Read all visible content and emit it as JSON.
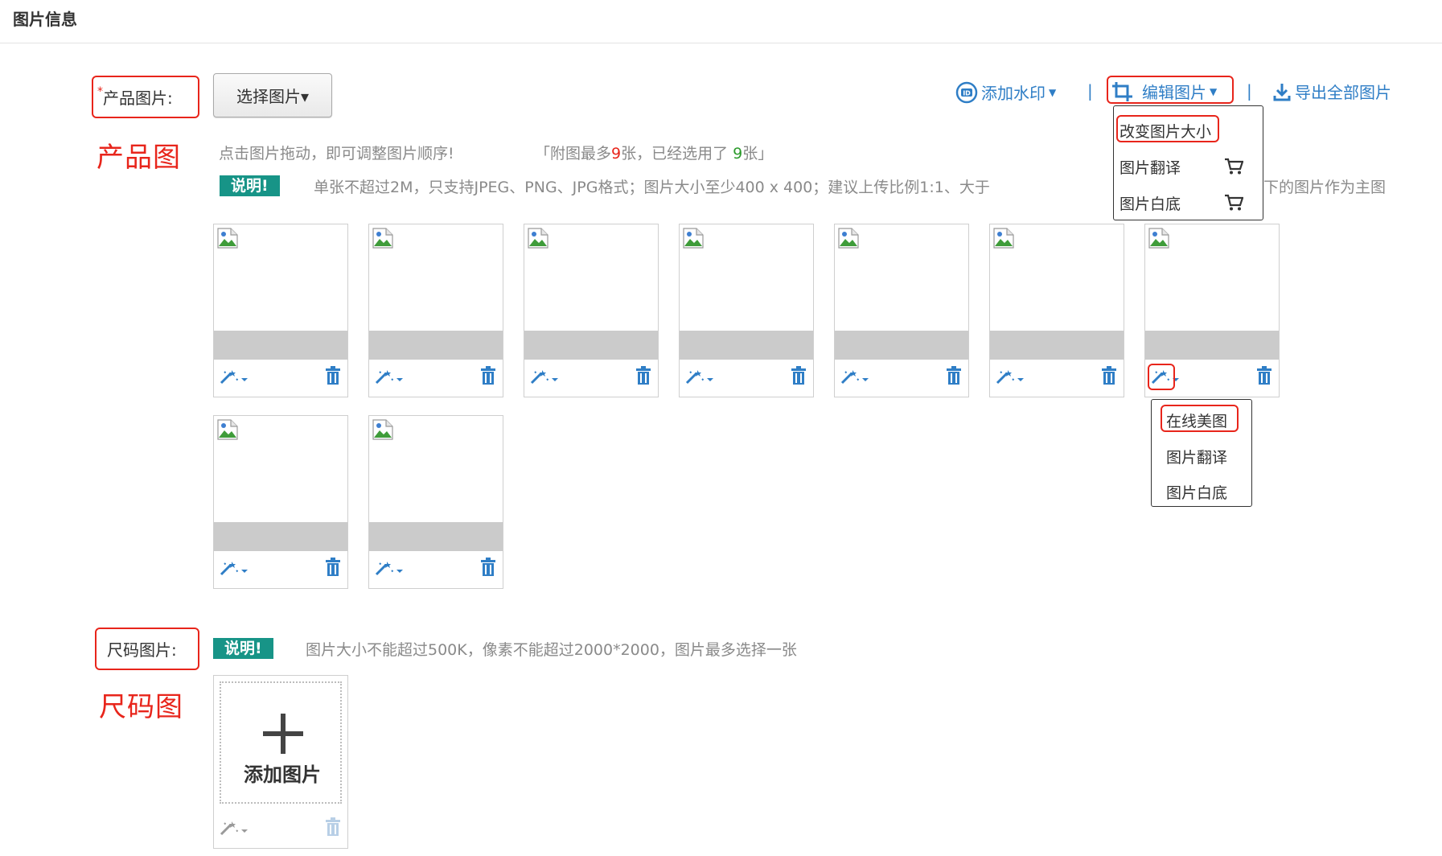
{
  "header": {
    "title": "图片信息"
  },
  "product": {
    "label_star": "*",
    "label": "产品图片:",
    "note": "产品图",
    "select_button": "选择图片▾",
    "hint_drag": "点击图片拖动，即可调整图片顺序!",
    "hint_limit_pre": "「附图最多",
    "hint_limit_max": "9",
    "hint_limit_mid": "张，已经选用了 ",
    "hint_limit_used": "9",
    "hint_limit_post": "张」",
    "badge": "说明!",
    "spec_text_left": "单张不超过2M，只支持JPEG、PNG、JPG格式；图片大小至少400 x 400；建议上传比例1:1、大于",
    "spec_text_right": "下的图片作为主图",
    "image_count": 9
  },
  "toolbar": {
    "watermark": "添加水印",
    "edit": "编辑图片",
    "export": "导出全部图片",
    "sep": "|"
  },
  "edit_menu": {
    "items": [
      "改变图片大小",
      "图片翻译",
      "图片白底"
    ]
  },
  "wand_menu": {
    "items": [
      "在线美图",
      "图片翻译",
      "图片白底"
    ]
  },
  "size": {
    "label": "尺码图片:",
    "note": "尺码图",
    "badge": "说明!",
    "spec_text": "图片大小不能超过500K，像素不能超过2000*2000，图片最多选择一张",
    "add_label": "添加图片",
    "add_symbol": "+"
  },
  "colors": {
    "accent_blue": "#2f7ec6",
    "badge_teal": "#179487",
    "annotation_red": "#e8251b"
  }
}
